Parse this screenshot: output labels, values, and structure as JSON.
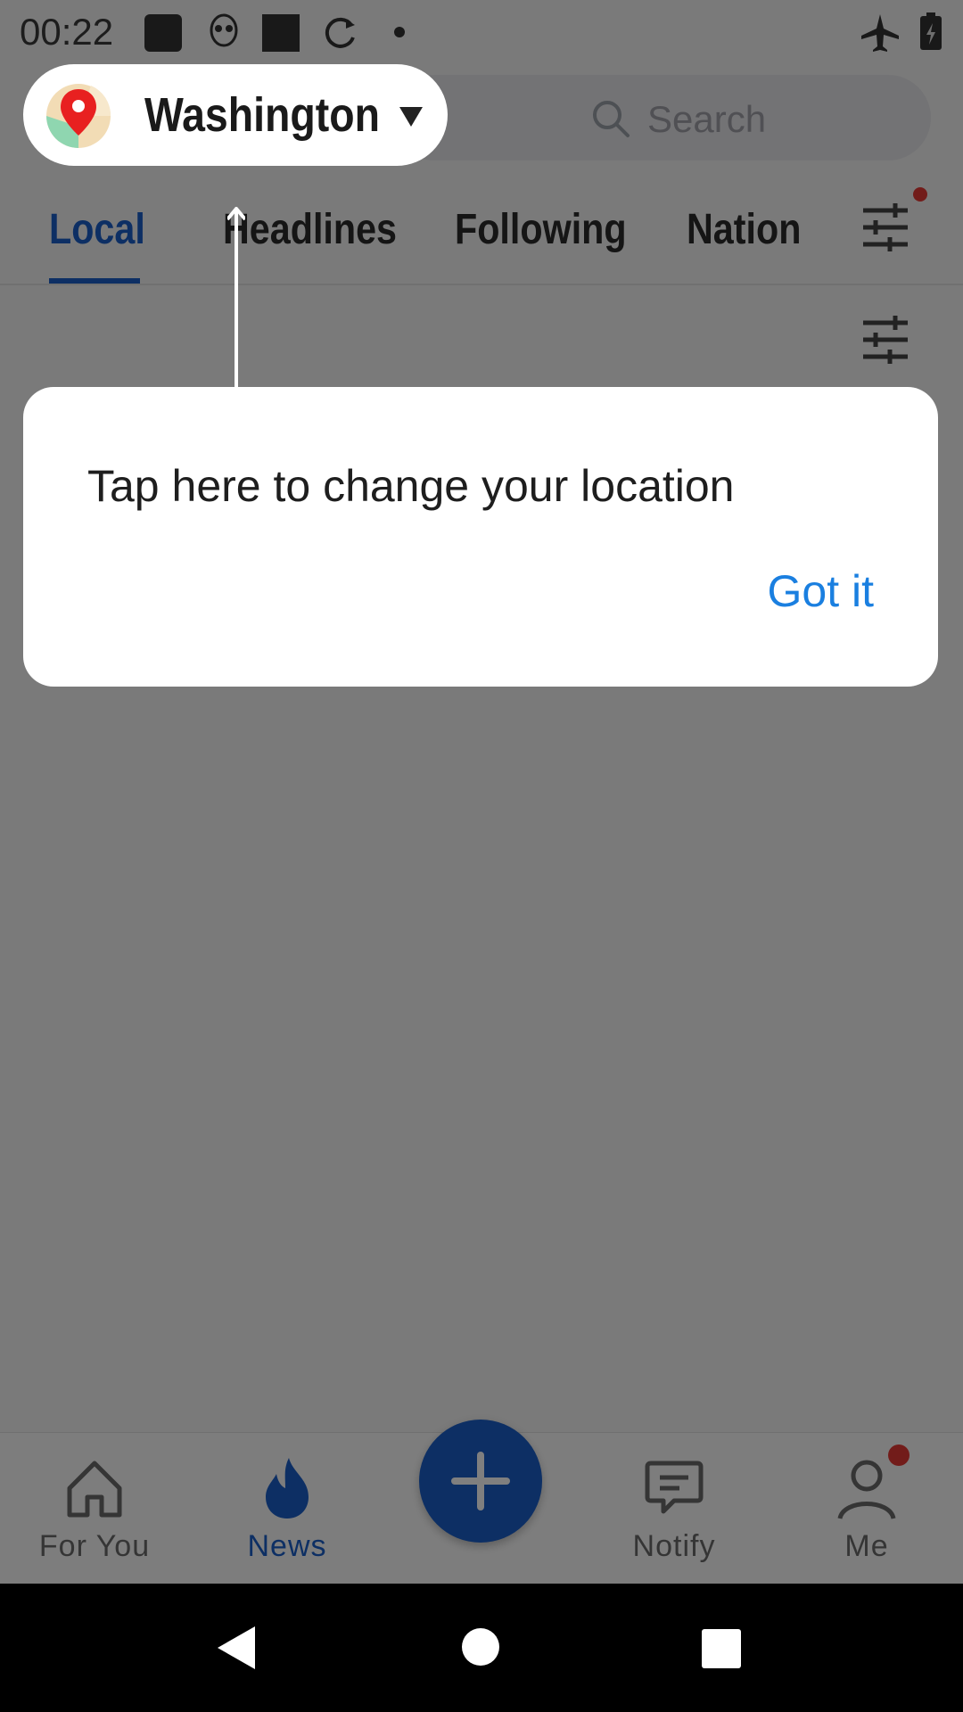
{
  "status_bar": {
    "time": "00:22",
    "icons": [
      "notification-square-icon",
      "alien-icon",
      "notification-square-icon",
      "sync-icon",
      "dot-icon",
      "airplane-mode-icon",
      "battery-charging-icon"
    ]
  },
  "location": {
    "name": "Washington",
    "icon": "map-pin-icon"
  },
  "search": {
    "placeholder": "Search"
  },
  "tabs": [
    {
      "label": "Local",
      "active": true
    },
    {
      "label": "Headlines",
      "active": false
    },
    {
      "label": "Following",
      "active": false
    },
    {
      "label": "Nation",
      "active": false
    }
  ],
  "tooltip": {
    "message": "Tap here to change your location",
    "button": "Got it"
  },
  "bottom_nav": [
    {
      "label": "For You",
      "icon": "home-icon",
      "active": false
    },
    {
      "label": "News",
      "icon": "flame-icon",
      "active": true
    },
    {
      "label": "Notify",
      "icon": "message-icon",
      "active": false
    },
    {
      "label": "Me",
      "icon": "person-icon",
      "active": false,
      "badge": true
    }
  ],
  "colors": {
    "accent": "#1a5fc8",
    "link": "#1a7fe0",
    "badge": "#e53935"
  }
}
